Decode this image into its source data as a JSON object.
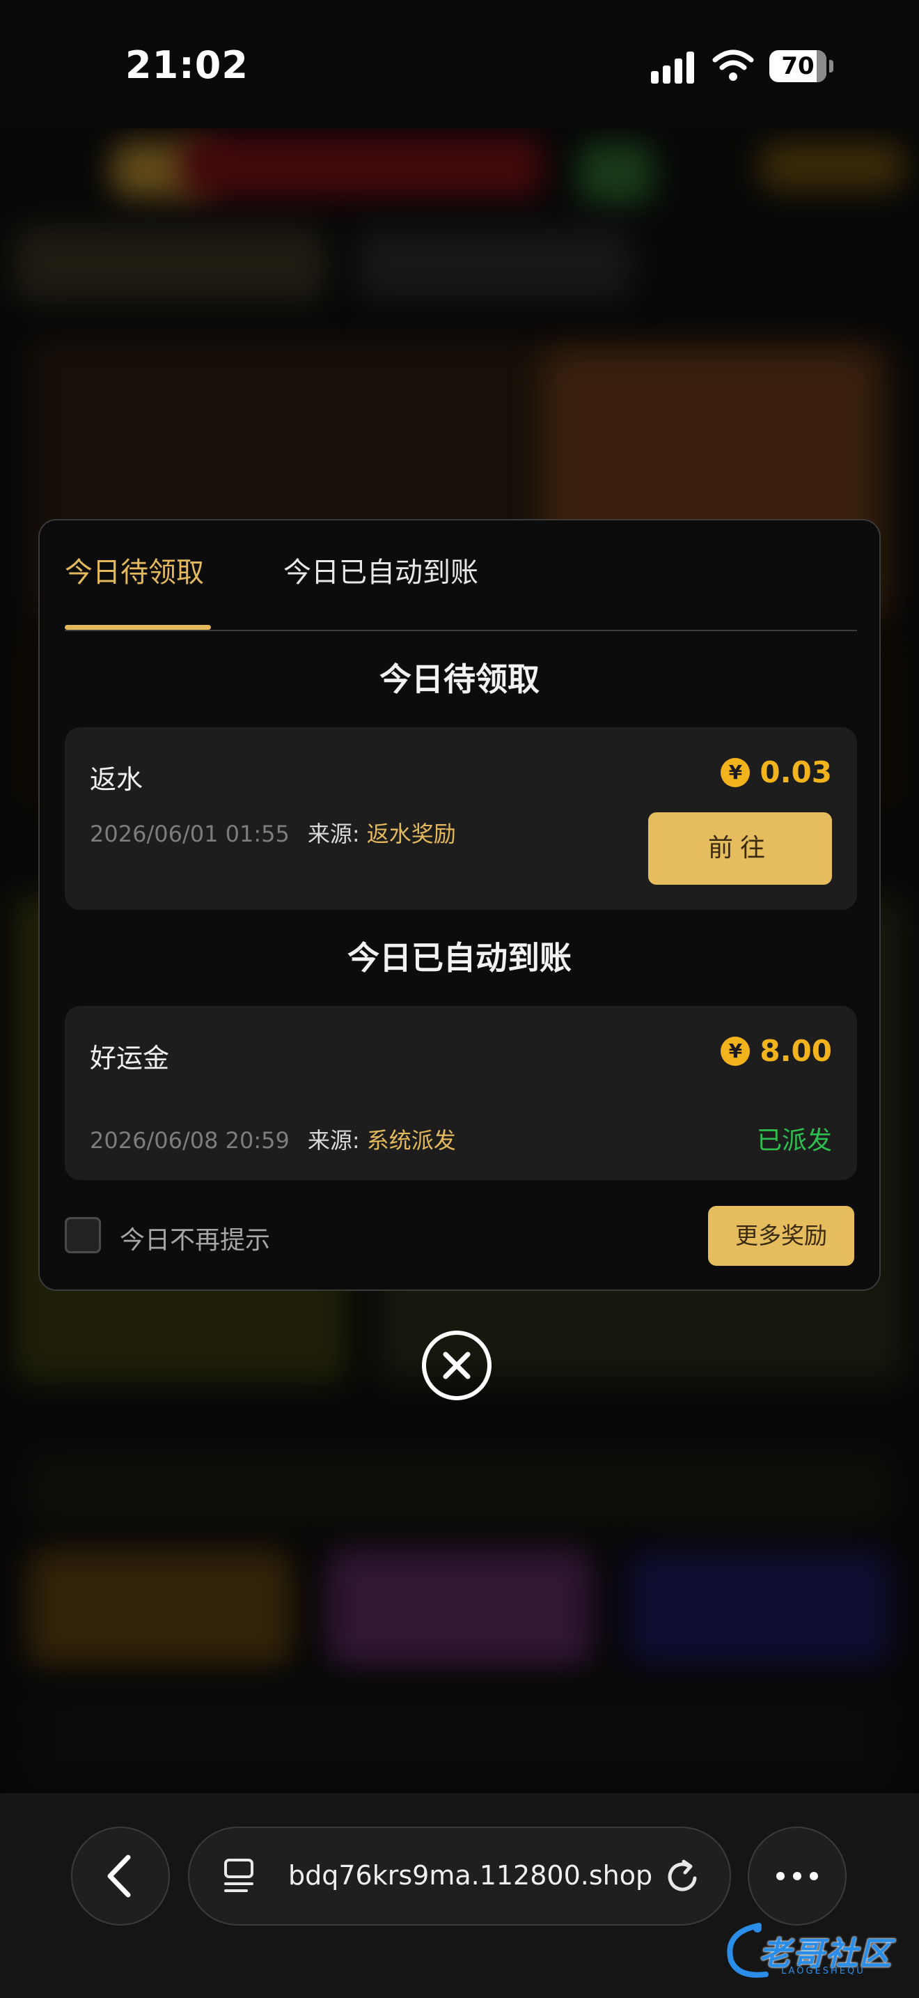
{
  "status_bar": {
    "time": "21:02",
    "battery": "70"
  },
  "tabs": [
    {
      "label": "今日待领取",
      "active": true
    },
    {
      "label": "今日已自动到账",
      "active": false
    }
  ],
  "pending": {
    "title": "今日待领取",
    "item": {
      "name": "返水",
      "amount": "0.03",
      "date": "2026/06/01 01:55",
      "source_label": "来源:",
      "source_value": "返水奖励",
      "action_label": "前往"
    }
  },
  "credited": {
    "title": "今日已自动到账",
    "item": {
      "name": "好运金",
      "amount": "8.00",
      "date": "2026/06/08 20:59",
      "source_label": "来源:",
      "source_value": "系统派发",
      "status": "已派发"
    }
  },
  "footer": {
    "dont_show_label": "今日不再提示",
    "dont_show_checked": false,
    "more_rewards_label": "更多奖励"
  },
  "currency_symbol": "¥",
  "browser": {
    "url": "bdq76krs9ma.112800.shop"
  },
  "watermark": {
    "text": "老哥社区",
    "sub": "LAOGESHEQU"
  },
  "colors": {
    "accent_gold": "#e3b95c",
    "amount_orange": "#f2b31c",
    "success_green": "#2fbf4f"
  }
}
